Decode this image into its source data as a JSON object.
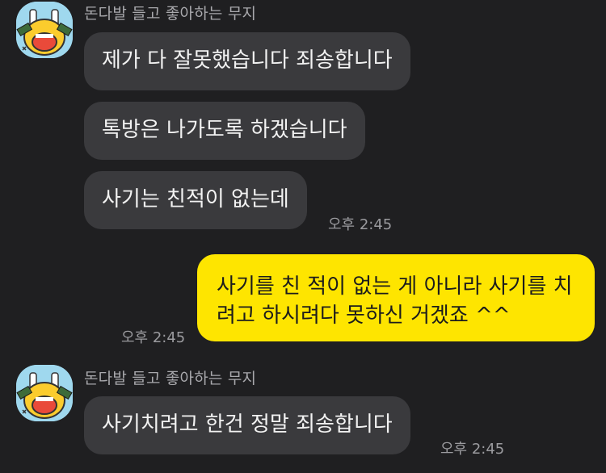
{
  "groups": [
    {
      "sender": "돈다발 들고 좋아하는 무지",
      "messages": [
        {
          "text": "제가 다 잘못했습니다 죄송합니다"
        },
        {
          "text": "톡방은 나가도록 하겠습니다"
        },
        {
          "text": "사기는 친적이 없는데",
          "time": "오후 2:45"
        }
      ]
    },
    {
      "sender": "",
      "messages": [
        {
          "text": "사기를 친 적이 없는 게 아니라 사기를 치려고 하시려다 못하신 거겠죠 ^^",
          "time": "오후 2:45",
          "mine": true
        }
      ]
    },
    {
      "sender": "돈다발 들고 좋아하는 무지",
      "messages": [
        {
          "text": "사기치려고 한건 정말 죄송합니다",
          "time": "오후 2:45"
        }
      ]
    }
  ],
  "colors": {
    "background": "#1f1f21",
    "incoming_bubble": "#3a3a3d",
    "outgoing_bubble": "#fee500",
    "avatar_bg": "#9fd8ee"
  },
  "icons": {
    "avatar": "muzi-money-avatar-icon"
  }
}
